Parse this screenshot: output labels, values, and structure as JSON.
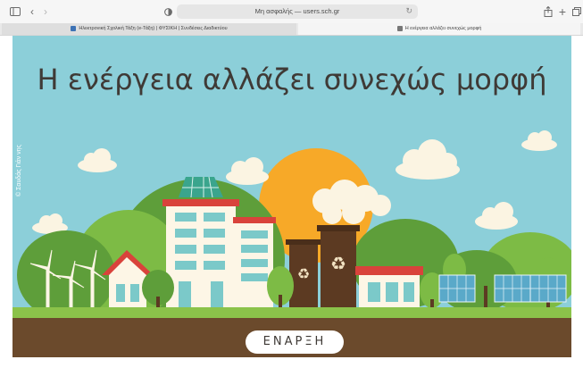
{
  "browser": {
    "address": "Μη ασφαλής — users.sch.gr",
    "tabs": [
      {
        "label": "Ηλεκτρονική Σχολική Τάξη (e-Τάξη) | ΦΥΣΙΚΗ | Συνδέσεις Διαδικτύου",
        "active": false
      },
      {
        "label": "Η ενέργεια αλλάζει συνεχώς μορφή",
        "active": true
      }
    ],
    "icons": [
      "sidebar-icon",
      "back-icon",
      "forward-icon",
      "privacy-icon",
      "reload-icon",
      "share-icon",
      "new-tab-icon",
      "tabs-overview-icon"
    ]
  },
  "scene": {
    "title": "Η ενέργεια αλλάζει συνεχώς μορφή",
    "credit": "© Σαυδάς Γιάν νης",
    "start_label": "ΕΝΑΡΞΗ"
  },
  "colors": {
    "sky": "#8ccfd9",
    "sun": "#f7a928",
    "hill_dark": "#5e9e3a",
    "hill_light": "#7dbb45",
    "ground": "#6b4a2c",
    "grass": "#8bc34a",
    "roof_red": "#d9433b",
    "smoke": "#fbf4e2",
    "title": "#3f3a36"
  }
}
